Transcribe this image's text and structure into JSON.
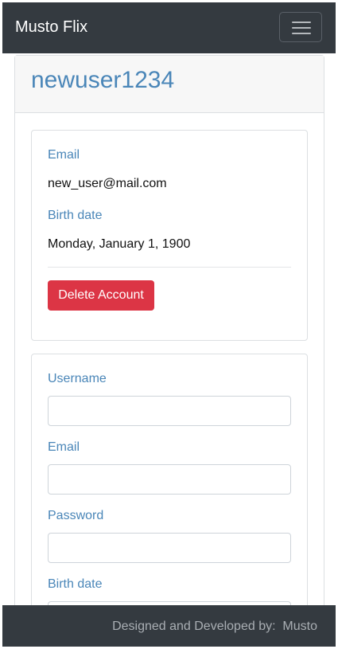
{
  "navbar": {
    "brand": "Musto Flix",
    "menu_icon": "hamburger-menu-icon"
  },
  "profile": {
    "username": "newuser1234",
    "email_label": "Email",
    "email_value": "new_user@mail.com",
    "birthdate_label": "Birth date",
    "birthdate_value": "Monday, January 1, 1900",
    "delete_button": "Delete Account"
  },
  "update_form": {
    "username_label": "Username",
    "username_value": "",
    "email_label": "Email",
    "email_value": "",
    "password_label": "Password",
    "password_value": "",
    "birthdate_label": "Birth date",
    "birthdate_value": ""
  },
  "footer": {
    "text": "Designed and Developed by:  Musto"
  },
  "colors": {
    "navbar_bg": "#343a40",
    "label": "#4a86b8",
    "danger": "#dc3545"
  }
}
